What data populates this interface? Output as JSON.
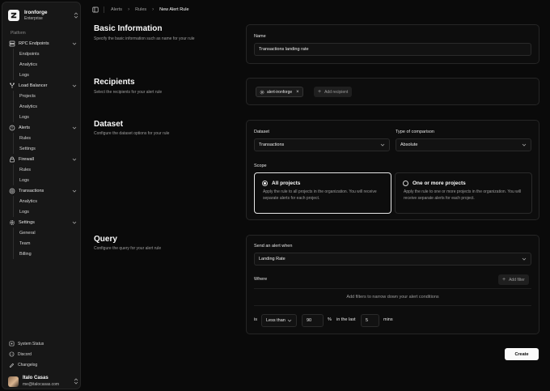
{
  "brand": {
    "name": "Ironforge",
    "plan": "Enterprise"
  },
  "sidebar": {
    "section_label": "Platform",
    "groups": [
      {
        "label": "RPC Endpoints",
        "icon": "server-icon",
        "items": [
          "Endpoints",
          "Analytics",
          "Logs"
        ]
      },
      {
        "label": "Load Balancer",
        "icon": "split-icon",
        "items": [
          "Projects",
          "Analytics",
          "Logs"
        ]
      },
      {
        "label": "Alerts",
        "icon": "alert-icon",
        "items": [
          "Rules",
          "Settings"
        ]
      },
      {
        "label": "Firewall",
        "icon": "lock-icon",
        "items": [
          "Rules",
          "Logs"
        ]
      },
      {
        "label": "Transactions",
        "icon": "transactions-icon",
        "items": [
          "Analytics",
          "Logs"
        ]
      },
      {
        "label": "Settings",
        "icon": "gear-icon",
        "items": [
          "General",
          "Team",
          "Billing"
        ]
      }
    ],
    "footer": [
      {
        "label": "System Status",
        "icon": "status-icon"
      },
      {
        "label": "Discord",
        "icon": "discord-icon"
      },
      {
        "label": "Changelog",
        "icon": "changelog-icon"
      }
    ],
    "user": {
      "name": "Italo Casas",
      "email": "me@italocasas.com"
    }
  },
  "breadcrumb": [
    "Alerts",
    "Rules",
    "New Alert Rule"
  ],
  "basic": {
    "title": "Basic Information",
    "description": "Specify the basic information such as name for your rule",
    "name_label": "Name",
    "name_value": "Transactions landing rate"
  },
  "recipients": {
    "title": "Recipients",
    "description": "Select the recipients for your alert rule",
    "chip": "alert-ironforge",
    "chip_remove": "×",
    "add_label": "Add recipient"
  },
  "dataset": {
    "title": "Dataset",
    "description": "Configure the dataset options for your rule",
    "dataset_label": "Dataset",
    "dataset_value": "Transactions",
    "comparison_label": "Type of comparison",
    "comparison_value": "Absolute",
    "scope_label": "Scope",
    "scope_all_title": "All projects",
    "scope_all_desc": "Apply the rule to all projects in the organization. You will receive separate alerts for each project.",
    "scope_some_title": "One or more projects",
    "scope_some_desc": "Apply the rule to one or more projects in the organization. You will receive separate alerts for each project."
  },
  "query": {
    "title": "Query",
    "description": "Configure the query for your alert rule",
    "send_label": "Send an alert when",
    "send_value": "Landing Rate",
    "where_label": "Where",
    "add_filter": "Add filter",
    "empty_text": "Add filters to narrow down your alert conditions",
    "is_label": "is",
    "operator": "Less than",
    "threshold": "90",
    "unit": "%",
    "in_last": "in the last",
    "window": "5",
    "window_unit": "mins"
  },
  "create_label": "Create"
}
